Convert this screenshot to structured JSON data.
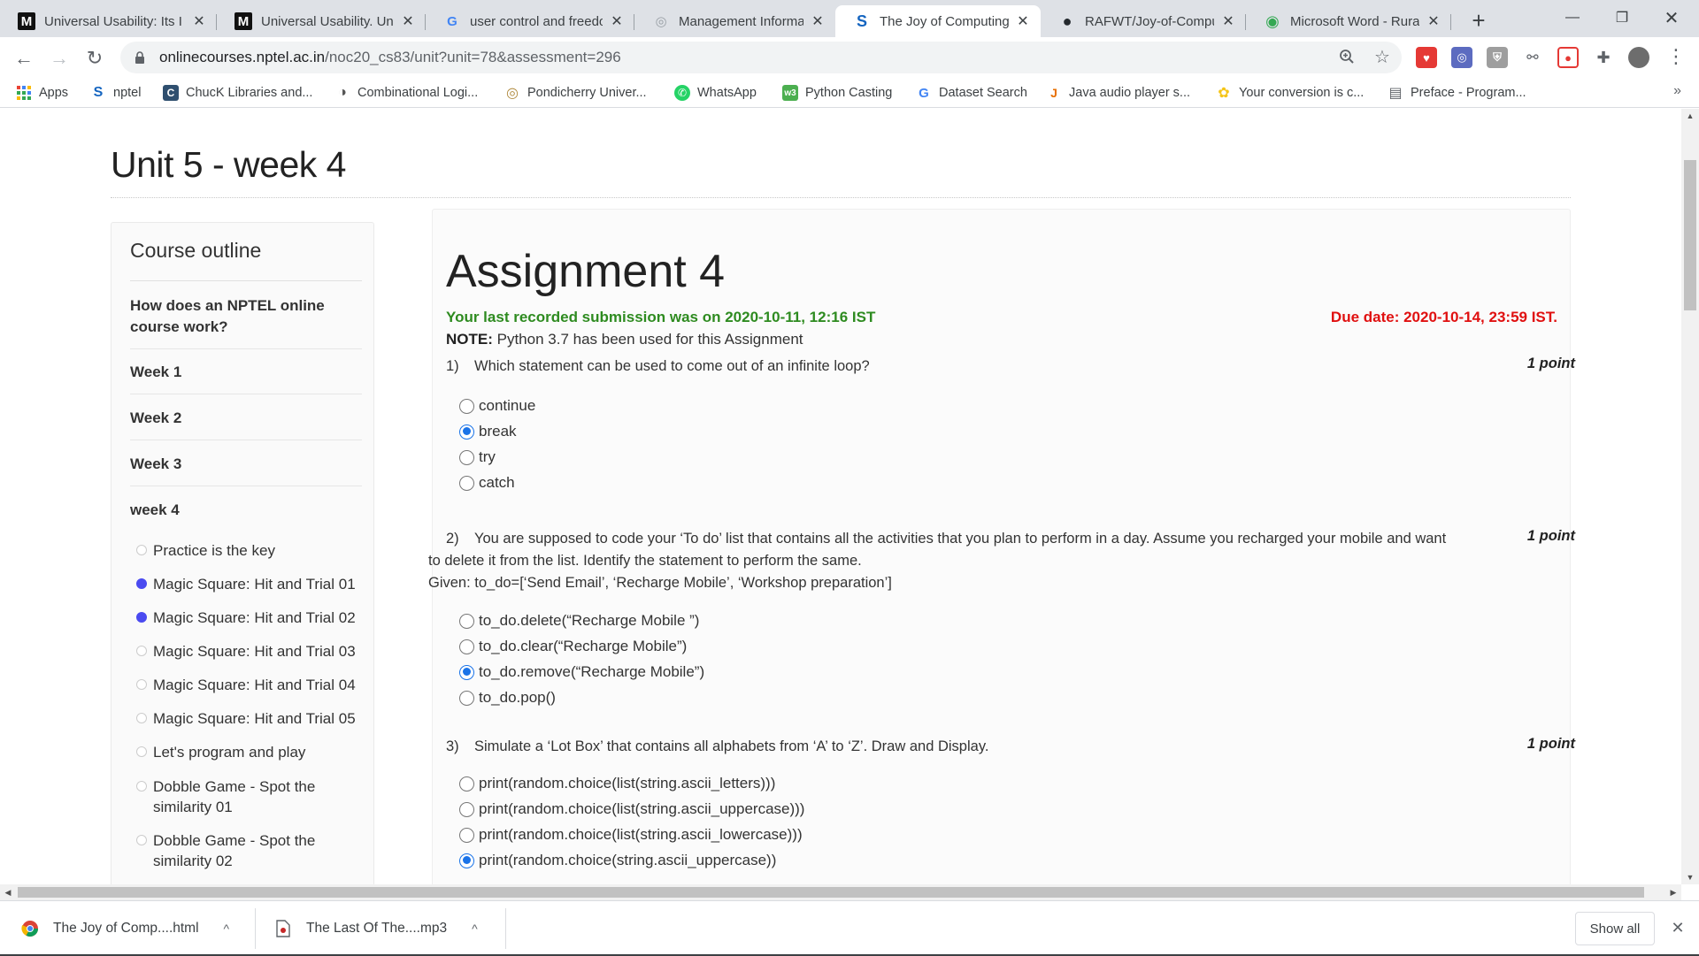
{
  "browser": {
    "tabs": [
      {
        "title": "Universal Usability: Its I",
        "icon": "medium-icon",
        "icon_glyph": "M"
      },
      {
        "title": "Universal Usability. Uni",
        "icon": "medium-icon",
        "icon_glyph": "M"
      },
      {
        "title": "user control and freedo",
        "icon": "google-icon",
        "icon_glyph": "G"
      },
      {
        "title": "Management Informati",
        "icon": "globe-icon",
        "icon_glyph": "◎"
      },
      {
        "title": "The Joy of Computing",
        "icon": "swayam-icon",
        "icon_glyph": "S",
        "active": true
      },
      {
        "title": "RAFWT/Joy-of-Compu",
        "icon": "github-icon",
        "icon_glyph": "●"
      },
      {
        "title": "Microsoft Word - Rural",
        "icon": "chrome-icon",
        "icon_glyph": "◉"
      }
    ],
    "close_glyph": "✕",
    "new_tab_glyph": "+",
    "window_controls": {
      "minimize": "—",
      "restore": "❐",
      "close": "✕"
    },
    "nav": {
      "back": "←",
      "forward": "→",
      "reload": "↻"
    },
    "url_host": "onlinecourses.nptel.ac.in",
    "url_path": "/noc20_cs83/unit?unit=78&assessment=296",
    "bookmarks": [
      {
        "label": "Apps",
        "icon": "apps-grid-icon",
        "glyph": "⋮⋮",
        "color": "#ea4335"
      },
      {
        "label": "nptel",
        "icon": "swayam-icon",
        "glyph": "S",
        "color": "#1565c0"
      },
      {
        "label": "ChucK Libraries and...",
        "icon": "chuck-icon",
        "glyph": "C",
        "color": "#2f4f6f"
      },
      {
        "label": "Combinational Logi...",
        "icon": "globe-icon",
        "glyph": "◑",
        "color": "#555555"
      },
      {
        "label": "Pondicherry Univer...",
        "icon": "university-icon",
        "glyph": "◎",
        "color": "#b08a3e"
      },
      {
        "label": "WhatsApp",
        "icon": "whatsapp-icon",
        "glyph": "✆",
        "color": "#25d366"
      },
      {
        "label": "Python Casting",
        "icon": "w3schools-icon",
        "glyph": "w3",
        "color": "#4caf50"
      },
      {
        "label": "Dataset Search",
        "icon": "google-icon",
        "glyph": "G",
        "color": "#4285f4"
      },
      {
        "label": "Java audio player s...",
        "icon": "java-icon",
        "glyph": "J",
        "color": "#e76f00"
      },
      {
        "label": "Your conversion is c...",
        "icon": "convert-icon",
        "glyph": "✿",
        "color": "#f5c518"
      },
      {
        "label": "Preface - Program...",
        "icon": "book-icon",
        "glyph": "▤",
        "color": "#5f6368"
      }
    ],
    "bookmarks_more": "»"
  },
  "page": {
    "unit_title": "Unit 5 - week 4",
    "sidebar": {
      "heading": "Course outline",
      "items": [
        "How does an NPTEL online course work?",
        "Week 1",
        "Week 2",
        "Week 3",
        "week 4"
      ],
      "subitems": [
        {
          "label": "Practice is the key",
          "done": false
        },
        {
          "label": "Magic Square: Hit and Trial 01",
          "done": true
        },
        {
          "label": "Magic Square: Hit and Trial 02",
          "done": true
        },
        {
          "label": "Magic Square: Hit and Trial 03",
          "done": false
        },
        {
          "label": "Magic Square: Hit and Trial 04",
          "done": false
        },
        {
          "label": "Magic Square: Hit and Trial 05",
          "done": false
        },
        {
          "label": "Let's program and play",
          "done": false
        },
        {
          "label": "Dobble Game - Spot the similarity 01",
          "done": false
        },
        {
          "label": "Dobble Game - Spot the similarity 02",
          "done": false
        }
      ]
    },
    "assignment": {
      "title": "Assignment 4",
      "last_submission": "Your last recorded submission was on 2020-10-11, 12:16 IST",
      "due_date": "Due date: 2020-10-14, 23:59 IST.",
      "note_label": "NOTE:",
      "note_text": " Python 3.7 has been used for this Assignment",
      "questions": [
        {
          "number": "1)",
          "text": "Which statement can be used to come out of an infinite loop?",
          "points": "1 point",
          "options": [
            "continue",
            "break",
            "try",
            "catch"
          ],
          "selected": 1
        },
        {
          "number": "2)",
          "text_line1": "You are supposed to code your ‘To do’ list that contains all the activities that you plan to perform in a day. Assume you recharged your mobile and want",
          "text_line2": "to delete it from the list. Identify the statement to perform the same.",
          "text_line3": "Given: to_do=[‘Send Email’, ‘Recharge Mobile’, ‘Workshop preparation’]",
          "points": "1 point",
          "options": [
            "to_do.delete(“Recharge Mobile ”)",
            "to_do.clear(“Recharge Mobile”)",
            "to_do.remove(“Recharge Mobile”)",
            "to_do.pop()"
          ],
          "selected": 2
        },
        {
          "number": "3)",
          "text": "Simulate a ‘Lot Box’ that contains all alphabets from ‘A’ to ‘Z’. Draw and Display.",
          "points": "1 point",
          "options": [
            "print(random.choice(list(string.ascii_letters)))",
            "print(random.choice(list(string.ascii_uppercase)))",
            "print(random.choice(list(string.ascii_lowercase)))",
            "print(random.choice(string.ascii_uppercase))"
          ],
          "selected": 3
        }
      ]
    }
  },
  "downloads": {
    "items": [
      {
        "label": "The Joy of Comp....html",
        "icon": "chrome-icon"
      },
      {
        "label": "The Last Of The....mp3",
        "icon": "audio-file-icon"
      }
    ],
    "caret": "^",
    "show_all": "Show all",
    "close": "✕"
  },
  "colors": {
    "accent": "#1a73e8",
    "submission_green": "#2e8b20",
    "due_red": "#e01010",
    "progress_dot": "#4a4af0"
  }
}
